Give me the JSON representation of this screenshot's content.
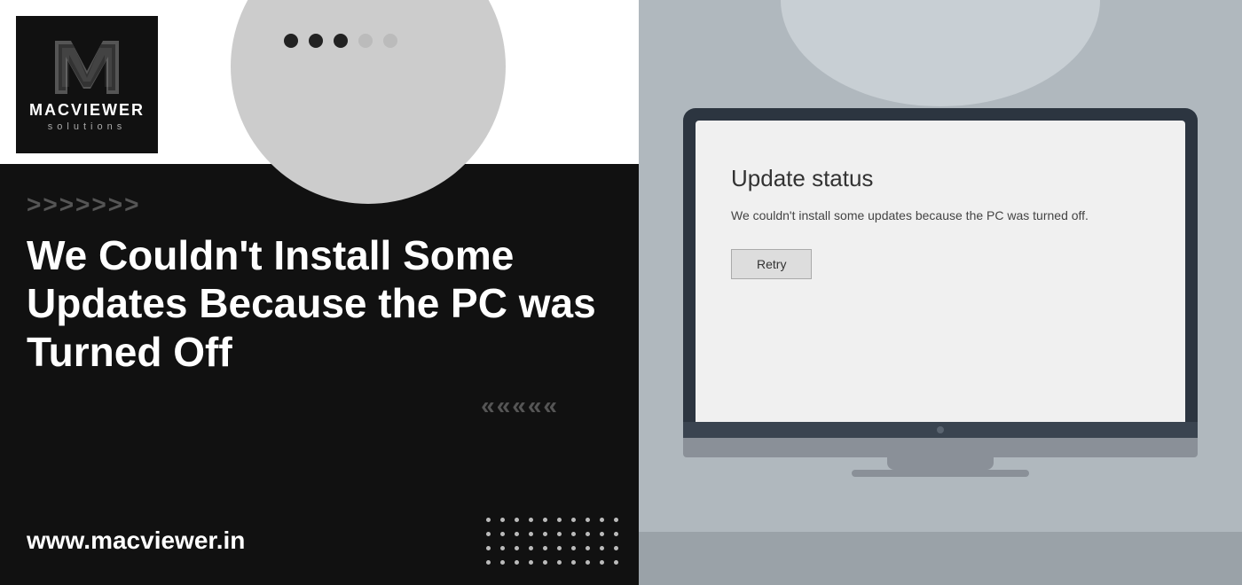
{
  "left": {
    "logo": {
      "letter": "M",
      "brand": "MACVIEWER",
      "sub": "solutions"
    },
    "dots": [
      {
        "state": "active"
      },
      {
        "state": "active"
      },
      {
        "state": "active"
      },
      {
        "state": "inactive"
      },
      {
        "state": "inactive"
      }
    ],
    "chevrons_top": ">>>>>>>",
    "headline": "We Couldn't Install Some Updates Because the PC was Turned Off",
    "chevrons_bottom": "«««««",
    "website": "www.macviewer.in"
  },
  "right": {
    "update_status": {
      "title": "Update status",
      "description": "We couldn't install some updates because the PC was turned off.",
      "retry_button": "Retry"
    }
  }
}
